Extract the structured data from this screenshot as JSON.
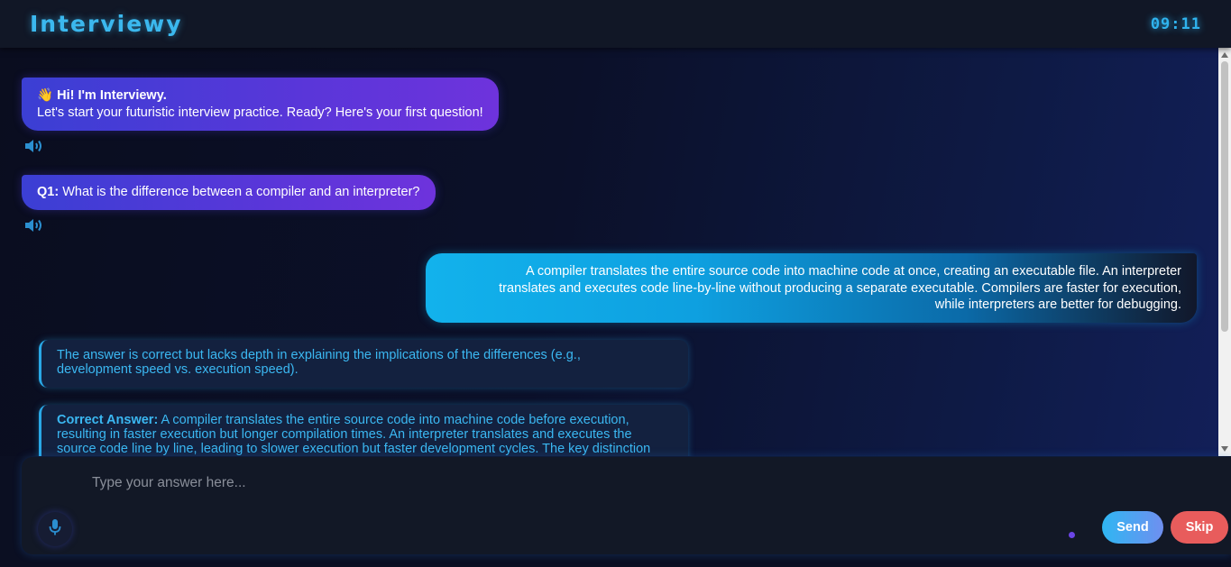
{
  "header": {
    "brand": "Interviewy",
    "timer": "09:11"
  },
  "messages": {
    "greeting": {
      "emoji": "👋",
      "title": "Hi! I'm Interviewy.",
      "text": "Let's start your futuristic interview practice. Ready? Here's your first question!"
    },
    "question": {
      "label": "Q1:",
      "text": "What is the difference between a compiler and an interpreter?"
    },
    "answer": {
      "line1": "A compiler translates the entire source code into machine code at once, creating an executable file. An interpreter",
      "line2": "translates and executes code line-by-line without producing a separate executable. Compilers are faster for execution,",
      "line3": "while interpreters are better for debugging."
    },
    "feedback": {
      "line1": "The answer is correct but lacks depth in explaining the implications of the differences (e.g.,",
      "line2": "development speed vs. execution speed)."
    },
    "correct_answer": {
      "label": "Correct Answer:",
      "line1": "A compiler translates the entire source code into machine code before execution,",
      "line2": "resulting in faster execution but longer compilation times. An interpreter translates and executes the",
      "line3": "source code line by line, leading to slower execution but faster development cycles. The key distinction"
    }
  },
  "input": {
    "placeholder": "Type your answer here...",
    "value": "",
    "send_label": "Send",
    "skip_label": "Skip"
  },
  "icons": {
    "speaker": "speaker-icon",
    "microphone": "microphone-icon"
  },
  "colors": {
    "accent": "#3bb8ee",
    "bot_bubble": "#5a36d9",
    "user_bubble": "#12b2ec",
    "skip": "#e85c5c"
  }
}
